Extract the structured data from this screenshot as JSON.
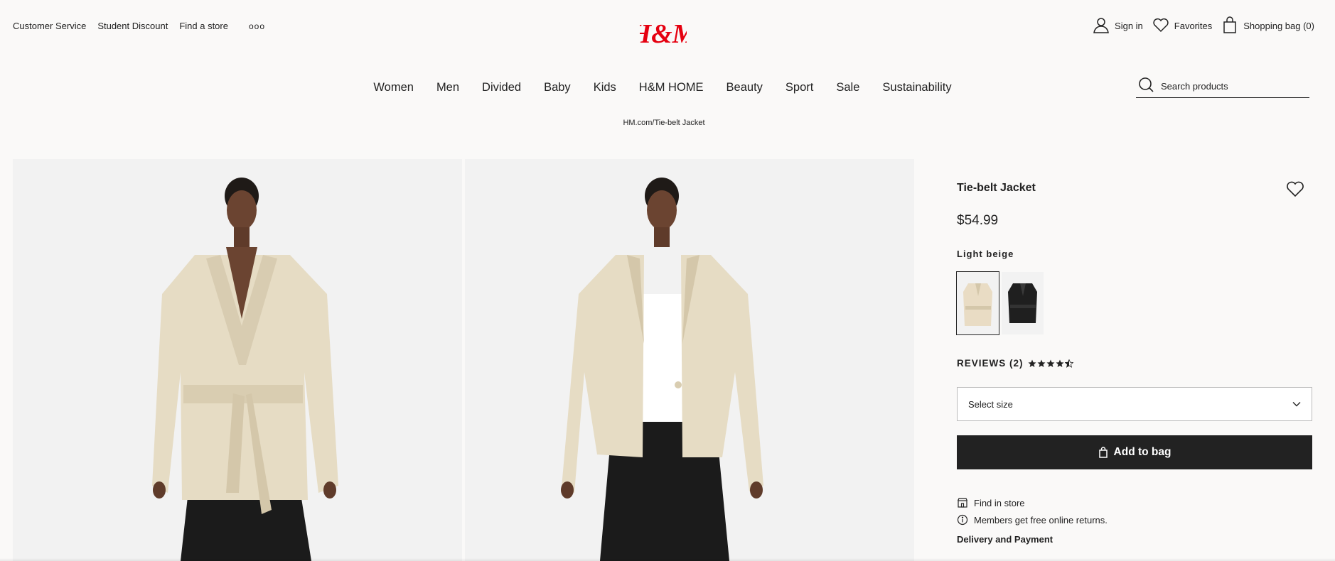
{
  "header": {
    "links": [
      "Customer Service",
      "Student Discount",
      "Find a store"
    ],
    "more_label": "ooo",
    "logo_text": "H&M",
    "brand_color": "#e50010",
    "sign_in": "Sign in",
    "favorites": "Favorites",
    "bag": "Shopping bag (0)"
  },
  "nav": {
    "items": [
      "Women",
      "Men",
      "Divided",
      "Baby",
      "Kids",
      "H&M HOME",
      "Beauty",
      "Sport",
      "Sale",
      "Sustainability"
    ]
  },
  "search": {
    "placeholder": "Search products"
  },
  "breadcrumb": "HM.com/Tie-belt Jacket",
  "product": {
    "name": "Tie-belt Jacket",
    "price": "$54.99",
    "color_name": "Light beige",
    "swatches": [
      {
        "name": "Light beige",
        "color": "#e9dcc4",
        "selected": true
      },
      {
        "name": "Black",
        "color": "#1f1f1f",
        "selected": false
      }
    ],
    "reviews_label": "REVIEWS (2)",
    "rating": 4.5,
    "size_placeholder": "Select size",
    "add_to_bag": "Add to bag",
    "find_in_store": "Find in store",
    "members_note": "Members get free online returns.",
    "delivery": "Delivery and Payment"
  },
  "icons": [
    "user-icon",
    "heart-icon",
    "bag-icon",
    "search-icon",
    "chevron-down-icon",
    "store-icon",
    "info-icon",
    "star-icon"
  ]
}
